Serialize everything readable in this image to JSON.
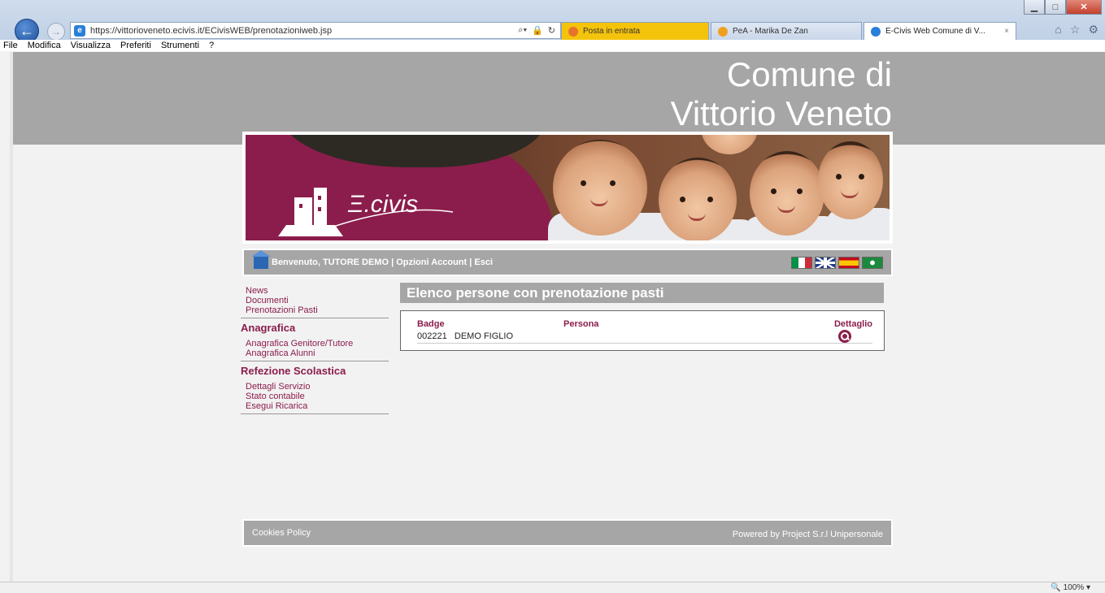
{
  "browser": {
    "url": "https://vittorioveneto.ecivis.it/ECivisWEB/prenotazioniweb.jsp",
    "tabs": [
      {
        "label": "Posta in entrata"
      },
      {
        "label": "PeA - Marika De Zan"
      },
      {
        "label": "E-Civis Web Comune di V...",
        "close": "×"
      }
    ],
    "menu": [
      "File",
      "Modifica",
      "Visualizza",
      "Preferiti",
      "Strumenti",
      "?"
    ],
    "zoom": "100%"
  },
  "header": {
    "title_line1": "Comune di",
    "title_line2": "Vittorio Veneto"
  },
  "banner": {
    "logo_text": "E.CIVIS"
  },
  "user_bar": {
    "text": "Benvenuto, TUTORE DEMO | Opzioni Account   | Esci"
  },
  "sidebar": {
    "links_top": [
      "News",
      "Documenti",
      "Prenotazioni Pasti"
    ],
    "section_anagrafica": {
      "title": "Anagrafica",
      "links": [
        "Anagrafica Genitore/Tutore",
        "Anagrafica Alunni"
      ]
    },
    "section_refezione": {
      "title": "Refezione Scolastica",
      "links": [
        "Dettagli Servizio",
        "Stato contabile",
        "Esegui Ricarica"
      ]
    }
  },
  "content": {
    "title": "Elenco persone con prenotazione pasti",
    "columns": {
      "badge": "Badge",
      "persona": "Persona",
      "dettaglio": "Dettaglio"
    },
    "rows": [
      {
        "badge": "002221",
        "persona": "DEMO FIGLIO"
      }
    ]
  },
  "footer": {
    "cookies": "Cookies Policy",
    "powered": "Powered by Project S.r.l Unipersonale"
  }
}
